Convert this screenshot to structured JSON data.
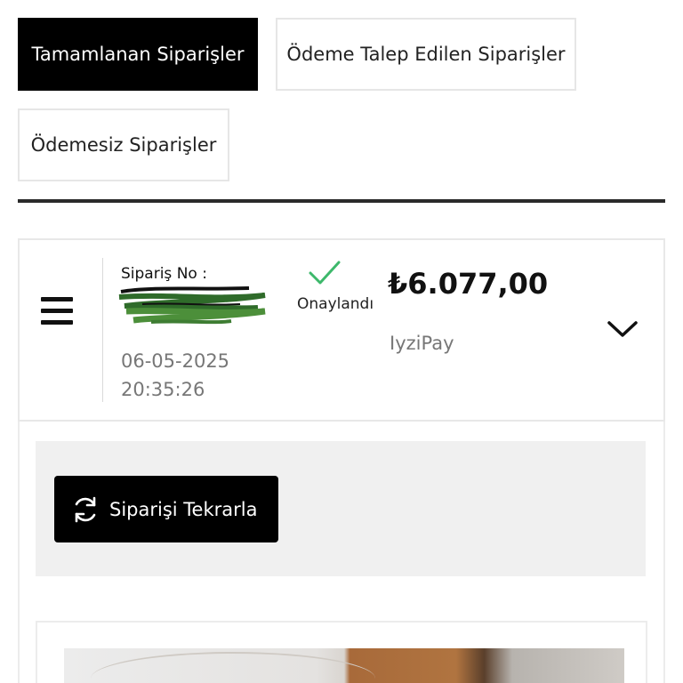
{
  "tabs": {
    "completed": "Tamamlanan Siparişler",
    "payment_requested": "Ödeme Talep Edilen Siparişler",
    "unpaid": "Ödemesiz Siparişler"
  },
  "order": {
    "number_label": "Sipariş No :",
    "date": "06-05-2025",
    "time": "20:35:26",
    "status": "Onaylandı",
    "status_color": "#3db86b",
    "amount": "₺6.077,00",
    "payment_method": "IyziPay"
  },
  "actions": {
    "reorder_label": "Siparişi Tekrarla",
    "reorder_icon": "refresh-icon"
  },
  "icons": {
    "menu": "hamburger-menu-icon",
    "expand": "chevron-down-icon",
    "status": "checkmark-icon"
  }
}
